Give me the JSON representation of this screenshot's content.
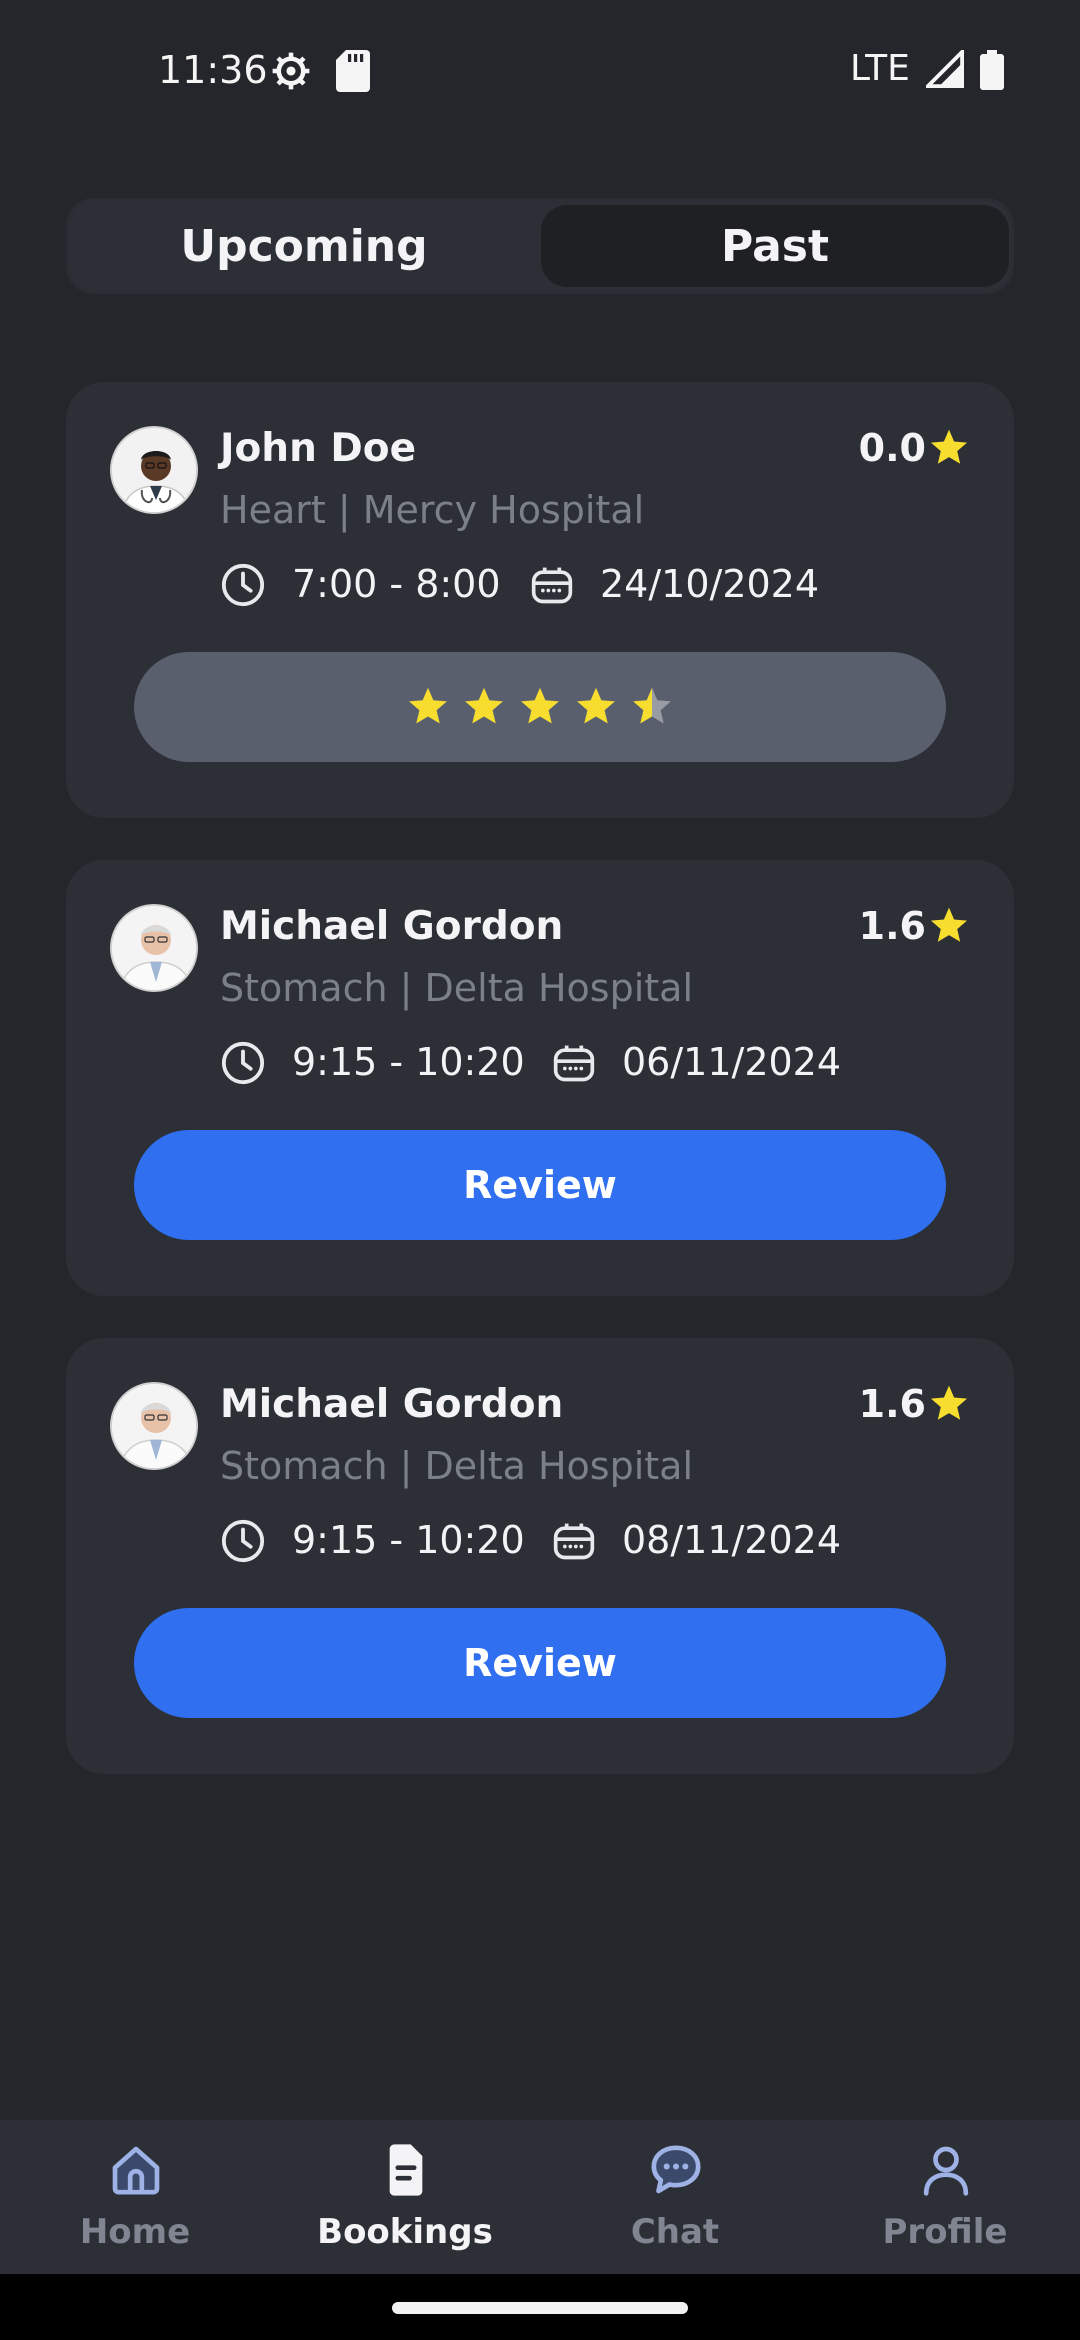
{
  "status_bar": {
    "time": "11:36",
    "network": "LTE",
    "icons": [
      "settings-gear-icon",
      "sd-card-icon",
      "signal-icon",
      "battery-icon"
    ]
  },
  "tabs": [
    {
      "label": "Upcoming",
      "selected": false
    },
    {
      "label": "Past",
      "selected": true
    }
  ],
  "bookings": [
    {
      "doctor": "John Doe",
      "rating": "0.0",
      "subtitle": "Heart | Mercy Hospital",
      "time": "7:00 - 8:00",
      "date": "24/10/2024",
      "user_rating_stars": 4.5,
      "action": null
    },
    {
      "doctor": "Michael Gordon",
      "rating": "1.6",
      "subtitle": "Stomach | Delta Hospital",
      "time": "9:15 - 10:20",
      "date": "06/11/2024",
      "action": "Review"
    },
    {
      "doctor": "Michael Gordon",
      "rating": "1.6",
      "subtitle": "Stomach | Delta Hospital",
      "time": "9:15 - 10:20",
      "date": "08/11/2024",
      "action": "Review"
    }
  ],
  "bottom_nav": [
    {
      "label": "Home",
      "icon": "home-icon",
      "active": false
    },
    {
      "label": "Bookings",
      "icon": "document-icon",
      "active": true
    },
    {
      "label": "Chat",
      "icon": "chat-bubble-icon",
      "active": false
    },
    {
      "label": "Profile",
      "icon": "person-icon",
      "active": false
    }
  ],
  "colors": {
    "background": "#24262b",
    "card": "#2c2f36",
    "accent_blue": "#2f6ff0",
    "star_yellow": "#f7de2e",
    "muted_text": "#7b8089"
  }
}
